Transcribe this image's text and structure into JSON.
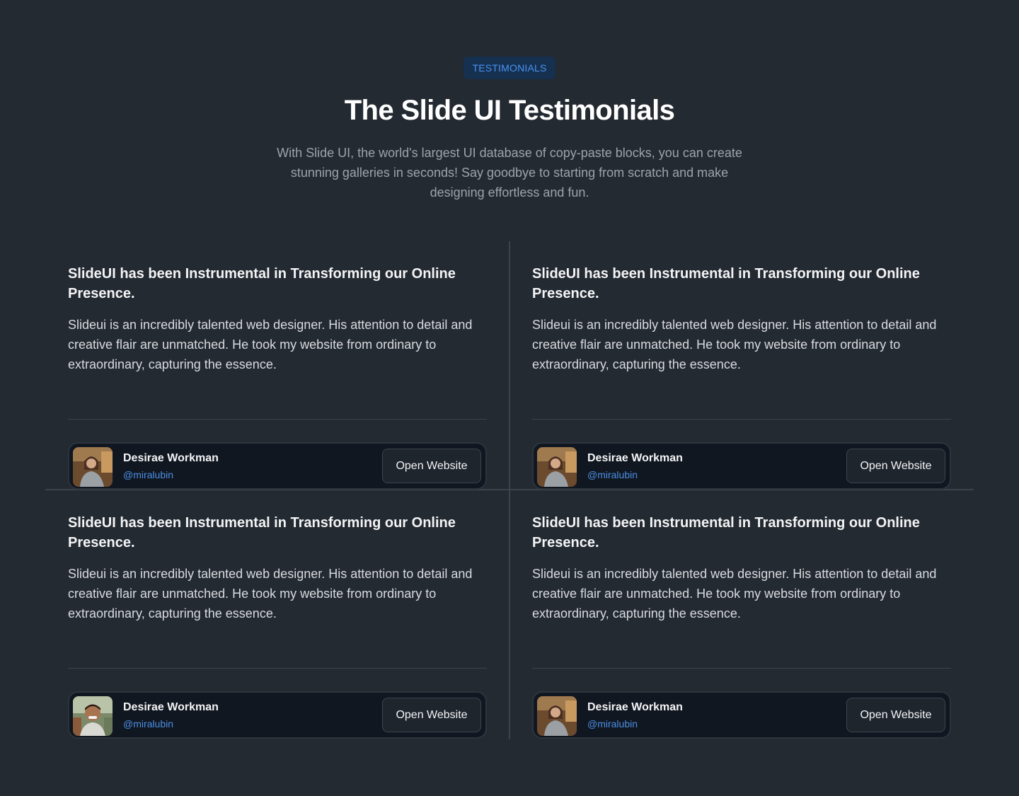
{
  "header": {
    "badge": "TESTIMONIALS",
    "title": "The Slide UI Testimonials",
    "subtitle": "With Slide UI, the world's largest UI database of copy-paste blocks, you can create stunning galleries in seconds! Say goodbye to starting from scratch and make designing effortless and fun."
  },
  "testimonials": [
    {
      "title": "SlideUI has been Instrumental in Transforming our Online Presence.",
      "body": "Slideui is an incredibly talented web designer. His attention to detail and creative flair are unmatched. He took my website from ordinary to extraordinary, capturing the essence.",
      "name": "Desirae Workman",
      "handle": "@miralubin",
      "button": "Open Website"
    },
    {
      "title": "SlideUI has been Instrumental in Transforming our Online Presence.",
      "body": "Slideui is an incredibly talented web designer. His attention to detail and creative flair are unmatched. He took my website from ordinary to extraordinary, capturing the essence.",
      "name": "Desirae Workman",
      "handle": "@miralubin",
      "button": "Open Website"
    },
    {
      "title": "SlideUI has been Instrumental in Transforming our Online Presence.",
      "body": "Slideui is an incredibly talented web designer. His attention to detail and creative flair are unmatched. He took my website from ordinary to extraordinary, capturing the essence.",
      "name": "Desirae Workman",
      "handle": "@miralubin",
      "button": "Open Website"
    },
    {
      "title": "SlideUI has been Instrumental in Transforming our Online Presence.",
      "body": "Slideui is an incredibly talented web designer. His attention to detail and creative flair are unmatched. He took my website from ordinary to extraordinary, capturing the essence.",
      "name": "Desirae Workman",
      "handle": "@miralubin",
      "button": "Open Website"
    }
  ],
  "colors": {
    "background": "#242a31",
    "accent": "#4a93f2",
    "handle": "#4a8fe6",
    "author_card": "#111720"
  }
}
